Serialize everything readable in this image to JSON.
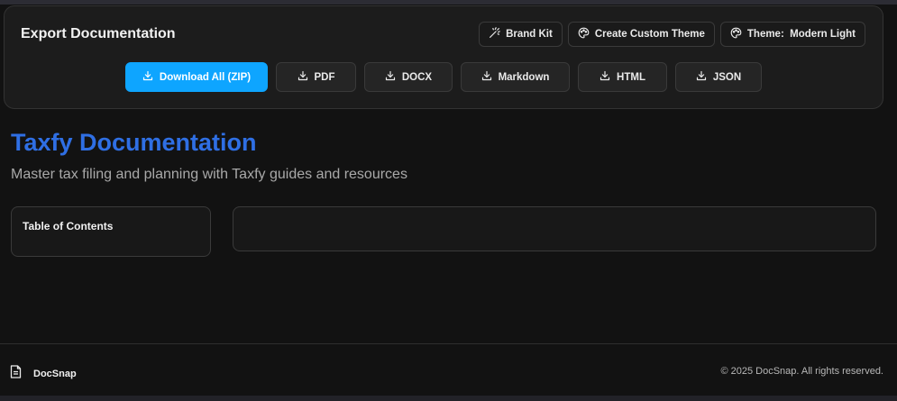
{
  "export": {
    "title": "Export Documentation",
    "theme_buttons": [
      {
        "label": "Brand Kit",
        "icon": "wand-icon"
      },
      {
        "label": "Create Custom Theme",
        "icon": "palette-icon"
      },
      {
        "label": "Theme:  Modern Light",
        "icon": "palette-icon"
      }
    ],
    "downloads": [
      {
        "label": "Download All (ZIP)",
        "icon": "download-icon",
        "primary": true
      },
      {
        "label": "PDF",
        "icon": "download-icon"
      },
      {
        "label": "DOCX",
        "icon": "download-icon"
      },
      {
        "label": "Markdown",
        "icon": "download-icon"
      },
      {
        "label": "HTML",
        "icon": "download-icon"
      },
      {
        "label": "JSON",
        "icon": "download-icon"
      }
    ]
  },
  "doc": {
    "title": "Taxfy Documentation",
    "subtitle": "Master tax filing and planning with Taxfy guides and resources"
  },
  "toc": {
    "label": "Table of Contents"
  },
  "footer": {
    "brand": "DocSnap",
    "brand_icon": "document-icon",
    "copyright": "© 2025 DocSnap. All rights reserved."
  },
  "colors": {
    "background": "#121212",
    "accent": "#0ea5ff",
    "title": "#2f6fe4"
  }
}
